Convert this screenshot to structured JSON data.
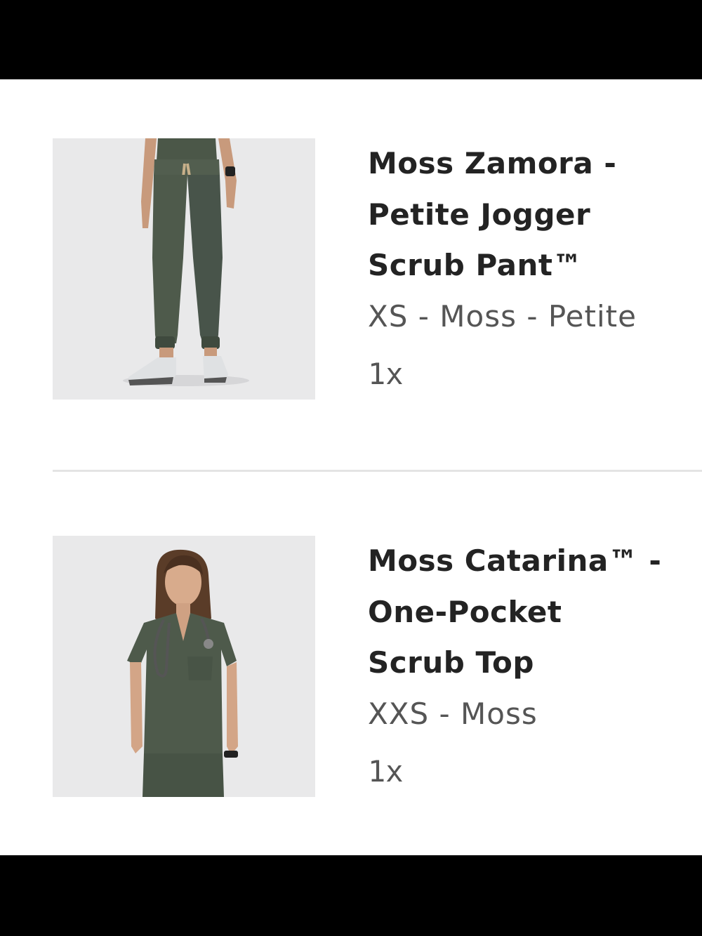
{
  "cart": {
    "items": [
      {
        "title_lines": [
          "Moss Zamora -",
          "Petite Jogger",
          "Scrub Pant™"
        ],
        "variant": "XS - Moss - Petite",
        "quantity": "1x",
        "image": "jogger-pant-photo"
      },
      {
        "title_lines": [
          "Moss Catarina™ -",
          "One-Pocket",
          "Scrub Top"
        ],
        "variant": "XXS - Moss",
        "quantity": "1x",
        "image": "scrub-top-photo"
      }
    ]
  },
  "colors": {
    "background": "#ffffff",
    "frame": "#000000",
    "title": "#232323",
    "secondary_text": "#555555",
    "divider": "#e4e4e4",
    "product_moss": "#4e5a4b",
    "thumbnail_bg": "#e9e9ea"
  }
}
